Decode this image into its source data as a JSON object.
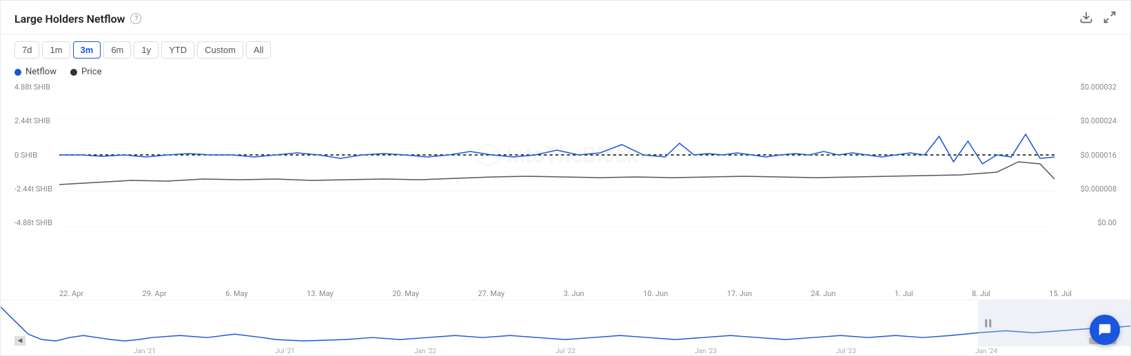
{
  "header": {
    "title": "Large Holders Netflow",
    "help_icon": "?",
    "download_icon": "⬇",
    "expand_icon": "⤢"
  },
  "toolbar": {
    "buttons": [
      {
        "label": "7d",
        "id": "7d",
        "active": false
      },
      {
        "label": "1m",
        "id": "1m",
        "active": false
      },
      {
        "label": "3m",
        "id": "3m",
        "active": true
      },
      {
        "label": "6m",
        "id": "6m",
        "active": false
      },
      {
        "label": "1y",
        "id": "1y",
        "active": false
      },
      {
        "label": "YTD",
        "id": "ytd",
        "active": false
      },
      {
        "label": "Custom",
        "id": "custom",
        "active": false
      },
      {
        "label": "All",
        "id": "all",
        "active": false
      }
    ]
  },
  "legend": [
    {
      "label": "Netflow",
      "color": "#1a56db"
    },
    {
      "label": "Price",
      "color": "#333"
    }
  ],
  "y_axis_left": [
    "4.88t SHIB",
    "2.44t SHIB",
    "0 SHIB",
    "-2.44t SHIB",
    "-4.88t SHIB"
  ],
  "y_axis_right": [
    "$0.000032",
    "$0.000024",
    "$0.000016",
    "$0.000008",
    "$0.00"
  ],
  "x_axis": [
    "22. Apr",
    "29. Apr",
    "6. May",
    "13. May",
    "20. May",
    "27. May",
    "3. Jun",
    "10. Jun",
    "17. Jun",
    "24. Jun",
    "1. Jul",
    "8. Jul",
    "15. Jul"
  ],
  "mini_x_axis": [
    "Jan '21",
    "Jul '21",
    "Jan '22",
    "Jul '22",
    "Jan '23",
    "Jul '23",
    "Jan '24"
  ],
  "watermark": "IntoTheBlock"
}
